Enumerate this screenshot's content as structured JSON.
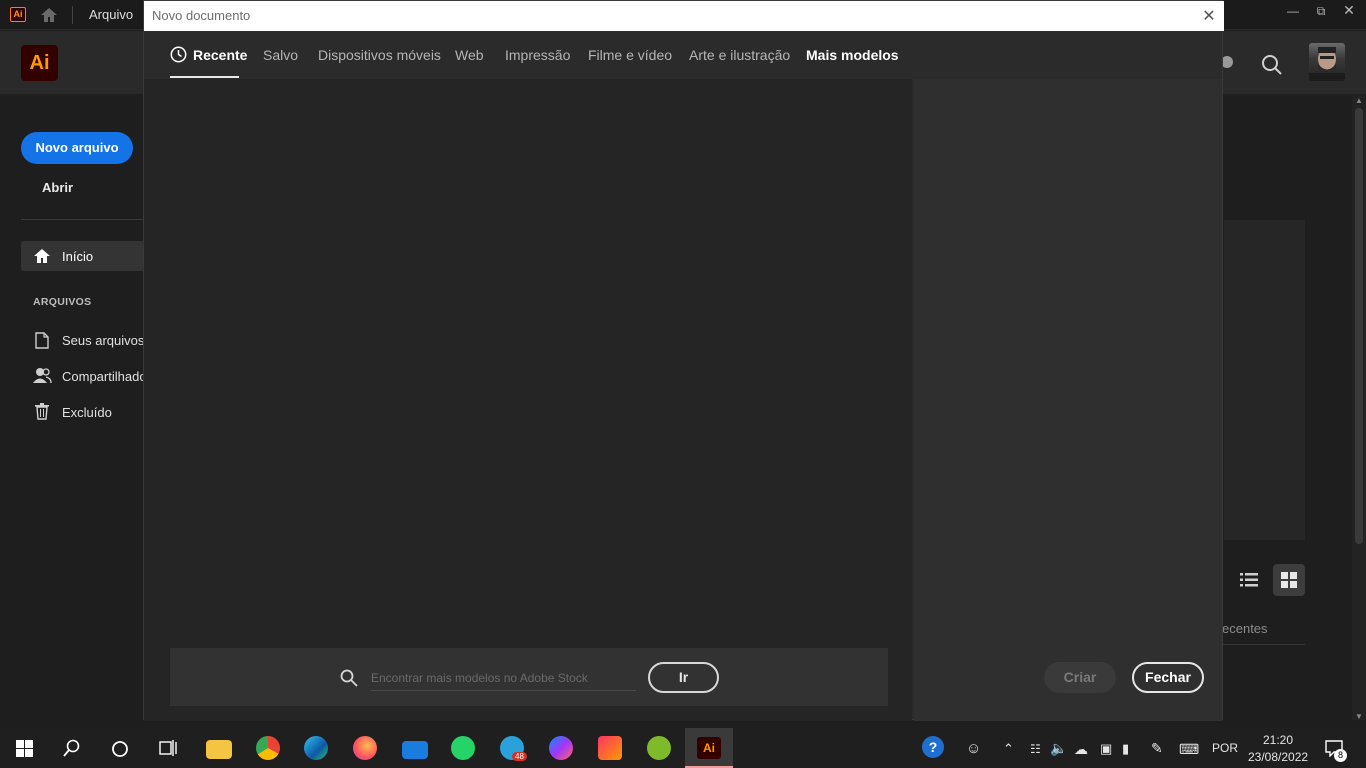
{
  "app_menu": {
    "file_label": "Arquivo"
  },
  "header": {
    "logo_text": "Ai"
  },
  "sidebar": {
    "new_file_label": "Novo arquivo",
    "open_label": "Abrir",
    "home_label": "Início",
    "files_section_title": "ARQUIVOS",
    "items": [
      {
        "label": "Seus arquivos",
        "icon": "file-icon"
      },
      {
        "label": "Compartilhado",
        "icon": "shared-users-icon"
      },
      {
        "label": "Excluído",
        "icon": "trash-icon"
      }
    ]
  },
  "background": {
    "recent_label": "ecentes"
  },
  "dialog": {
    "title": "Novo documento",
    "tabs": [
      {
        "label": "Recente",
        "icon": "clock-icon",
        "active": true
      },
      {
        "label": "Salvo"
      },
      {
        "label": "Dispositivos móveis"
      },
      {
        "label": "Web"
      },
      {
        "label": "Impressão"
      },
      {
        "label": "Filme e vídeo"
      },
      {
        "label": "Arte e ilustração"
      },
      {
        "label": "Mais modelos"
      }
    ],
    "search": {
      "placeholder": "Encontrar mais modelos no Adobe Stock",
      "go_label": "Ir"
    },
    "create_label": "Criar",
    "close_label": "Fechar"
  },
  "taskbar": {
    "language": "POR",
    "time": "21:20",
    "date": "23/08/2022",
    "telegram_badge": "48",
    "notification_count": "8",
    "apps": [
      "start",
      "search",
      "cortana",
      "task-view",
      "file-explorer",
      "chrome",
      "edge",
      "firefox",
      "mail",
      "whatsapp",
      "telegram",
      "messenger",
      "creative-cloud",
      "app-installer",
      "illustrator"
    ]
  },
  "colors": {
    "accent": "#1473e6",
    "ai_brand": "#ff9a00",
    "ai_bg": "#330000"
  }
}
